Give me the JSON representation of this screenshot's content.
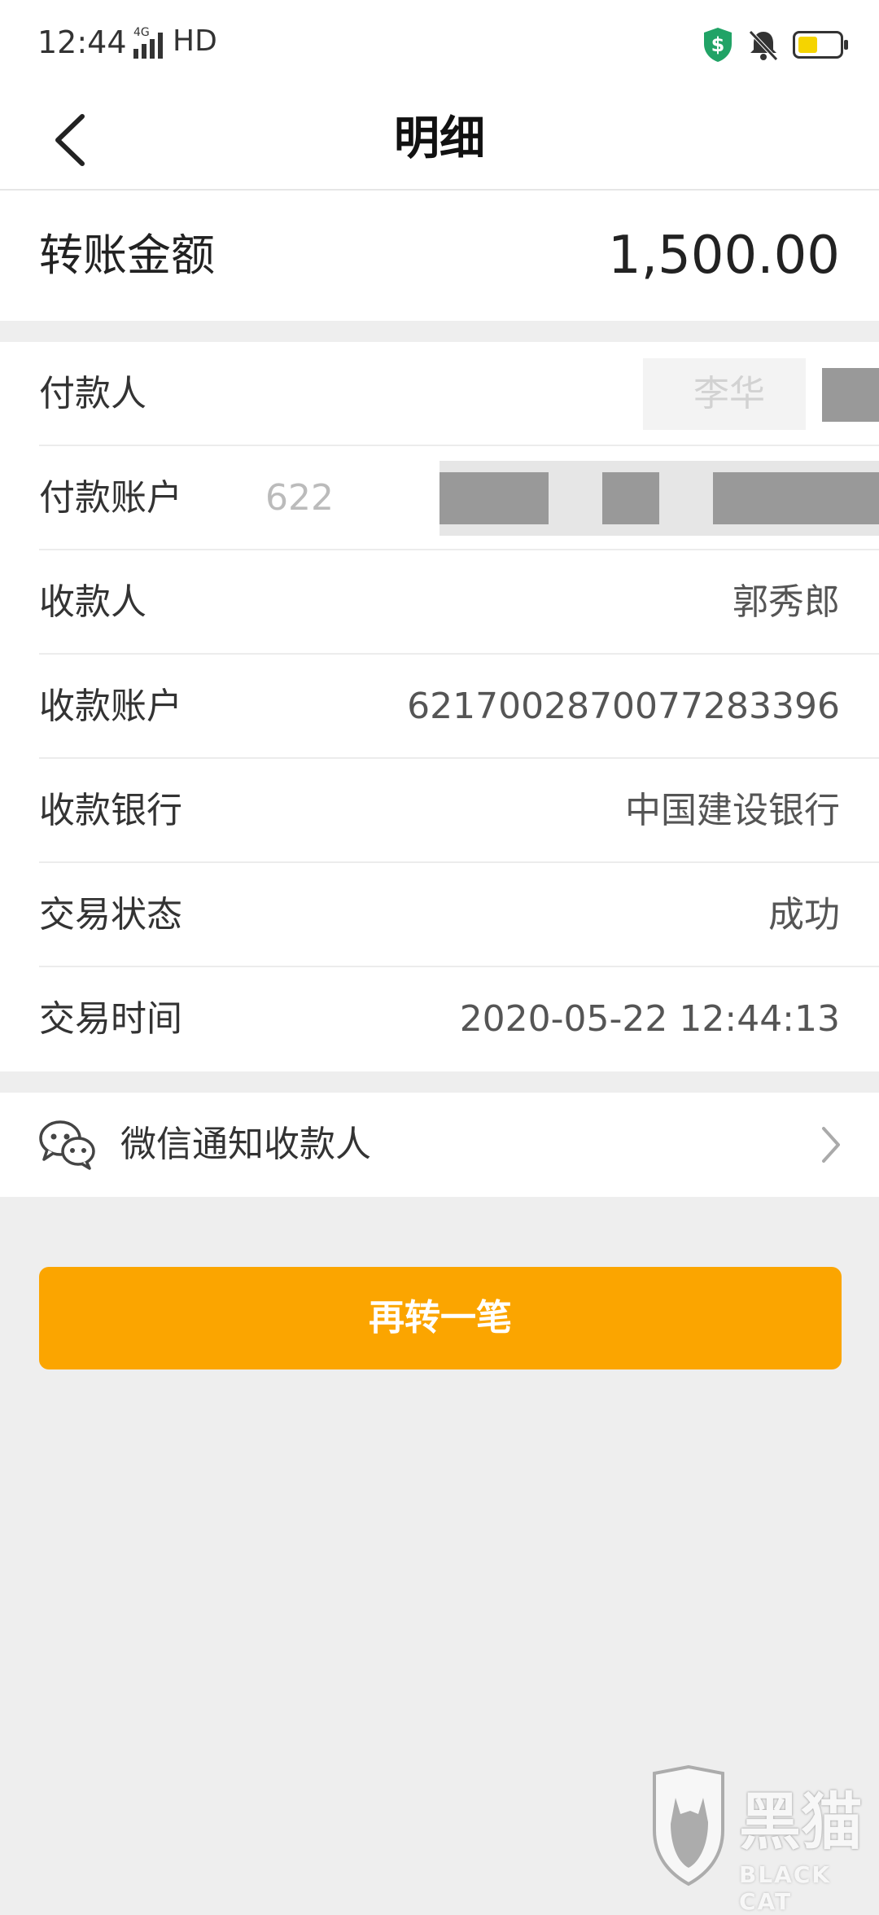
{
  "status_bar": {
    "time": "12:44",
    "network": "HD",
    "signal_label": "4G",
    "battery_level": 0.45,
    "shield_color": "#21a366",
    "battery_color": "#f5d400"
  },
  "nav": {
    "title": "明细",
    "back_icon": "chevron-left-icon"
  },
  "amount": {
    "label": "转账金额",
    "value": "1,500.00"
  },
  "details": [
    {
      "label": "付款人",
      "value": "李华",
      "redacted": true
    },
    {
      "label": "付款账户",
      "value": "622",
      "redacted": true
    },
    {
      "label": "收款人",
      "value": "郭秀郎"
    },
    {
      "label": "收款账户",
      "value": "6217002870077283396"
    },
    {
      "label": "收款银行",
      "value": "中国建设银行"
    },
    {
      "label": "交易状态",
      "value": "成功"
    },
    {
      "label": "交易时间",
      "value": "2020-05-22 12:44:13"
    }
  ],
  "wechat_notify": {
    "label": "微信通知收款人",
    "icon": "wechat-icon"
  },
  "actions": {
    "transfer_again": "再转一笔"
  },
  "watermark": {
    "brand": "黑猫",
    "sub": "BLACK CAT"
  },
  "colors": {
    "accent": "#fba500",
    "background": "#eeeeee"
  }
}
